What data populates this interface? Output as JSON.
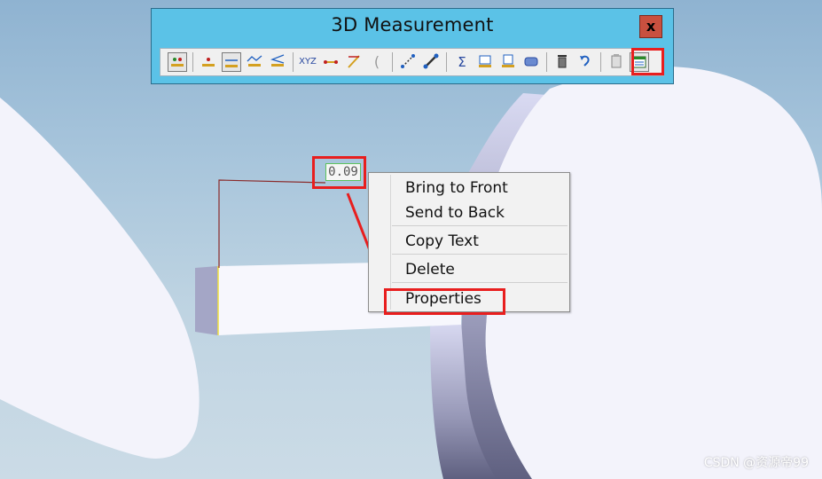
{
  "window": {
    "title": "3D Measurement",
    "close_label": "x"
  },
  "toolbar": {
    "buttons": [
      {
        "icon": "point-marker-icon"
      },
      {
        "icon": "point-measure-icon"
      },
      {
        "icon": "line-measure-icon"
      },
      {
        "icon": "polyline-measure-icon"
      },
      {
        "icon": "angle-measure-icon"
      },
      {
        "icon": "coordinate-icon",
        "label": "XYZ"
      },
      {
        "icon": "distance-icon"
      },
      {
        "icon": "angle-arc-icon"
      },
      {
        "icon": "arc-icon"
      },
      {
        "icon": "point-to-point-icon"
      },
      {
        "icon": "link-icon"
      },
      {
        "icon": "sum-icon",
        "label": "Σ"
      },
      {
        "icon": "area-icon"
      },
      {
        "icon": "volume-icon"
      },
      {
        "icon": "cylinder-icon"
      },
      {
        "icon": "delete-icon"
      },
      {
        "icon": "undo-icon"
      },
      {
        "icon": "clipboard-icon"
      },
      {
        "icon": "properties-panel-icon"
      }
    ]
  },
  "dimension_label": "0.09",
  "context_menu": {
    "items": [
      "Bring to Front",
      "Send to Back",
      "Copy Text",
      "Delete",
      "Properties"
    ]
  },
  "watermark": "CSDN @资源帝99",
  "colors": {
    "highlight": "#e81e1e",
    "titlebar": "#5bc2e7",
    "model_face": "#f3f3fb",
    "model_edge": "#7c80a6"
  }
}
